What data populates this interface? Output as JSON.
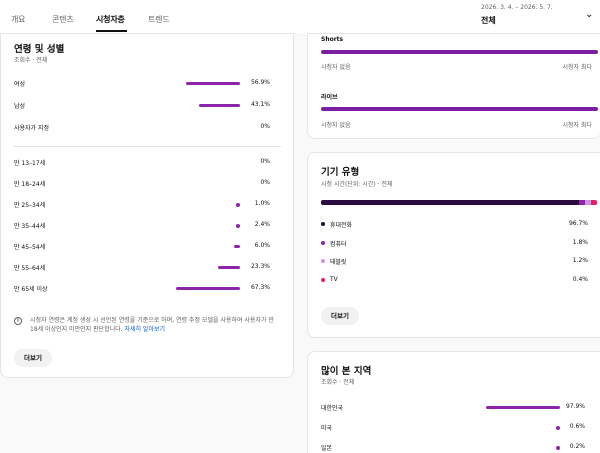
{
  "tabs": [
    {
      "label": "개요",
      "active": false
    },
    {
      "label": "콘텐츠",
      "active": false
    },
    {
      "label": "시청자층",
      "active": true
    },
    {
      "label": "트렌드",
      "active": false
    }
  ],
  "date": {
    "range": "2026. 3. 4. – 2026. 5. 7.",
    "label": "전체"
  },
  "age_gender": {
    "title": "연령 및 성별",
    "subtitle": "조회수 · 전체",
    "gender": [
      {
        "label": "여성",
        "value": "56.9%",
        "pct": 56.9
      },
      {
        "label": "남성",
        "value": "43.1%",
        "pct": 43.1
      },
      {
        "label": "사용자가 지정",
        "value": "0%",
        "pct": 0
      }
    ],
    "ages": [
      {
        "label": "만 13–17세",
        "value": "0%",
        "pct": 0
      },
      {
        "label": "만 18–24세",
        "value": "0%",
        "pct": 0
      },
      {
        "label": "만 25–34세",
        "value": "1.0%",
        "pct": 1.0
      },
      {
        "label": "만 35–44세",
        "value": "2.4%",
        "pct": 2.4
      },
      {
        "label": "만 45–54세",
        "value": "6.0%",
        "pct": 6.0
      },
      {
        "label": "만 55–64세",
        "value": "23.3%",
        "pct": 23.3
      },
      {
        "label": "만 65세 이상",
        "value": "67.3%",
        "pct": 67.3
      }
    ],
    "info_text": "시청자 연령은 계정 생성 시 선언된 연령을 기준으로 하며, 연령 추정 모델을 사용하여 사용자가 만 18세 이상인지 미만인지 판단합니다.",
    "info_link": "자세히 알아보기",
    "more_label": "더보기"
  },
  "content_type": {
    "shorts_label": "Shorts",
    "live_label": "라이브",
    "none_label": "시청자 없음",
    "max_label": "시청자 최다"
  },
  "device": {
    "title": "기기 유형",
    "subtitle": "시청 시간(단위: 시간) · 전체",
    "items": [
      {
        "label": "휴대전화",
        "value": "96.7%",
        "pct": 96.7,
        "color": "#2b0b3f"
      },
      {
        "label": "컴퓨터",
        "value": "1.8%",
        "pct": 1.8,
        "color": "#8e24aa"
      },
      {
        "label": "태블릿",
        "value": "1.2%",
        "pct": 1.2,
        "color": "#ce93d8"
      },
      {
        "label": "TV",
        "value": "0.4%",
        "pct": 0.4,
        "color": "#e91e63"
      }
    ],
    "more_label": "더보기"
  },
  "geography": {
    "title": "많이 본 지역",
    "subtitle": "조회수 · 전체",
    "items": [
      {
        "label": "대한민국",
        "value": "97.9%",
        "pct": 97.9
      },
      {
        "label": "미국",
        "value": "0.6%",
        "pct": 0.6
      },
      {
        "label": "일본",
        "value": "0.2%",
        "pct": 0.2
      }
    ]
  },
  "colors": {
    "accent": "#8e24aa",
    "device_phone": "#2b0b3f"
  }
}
